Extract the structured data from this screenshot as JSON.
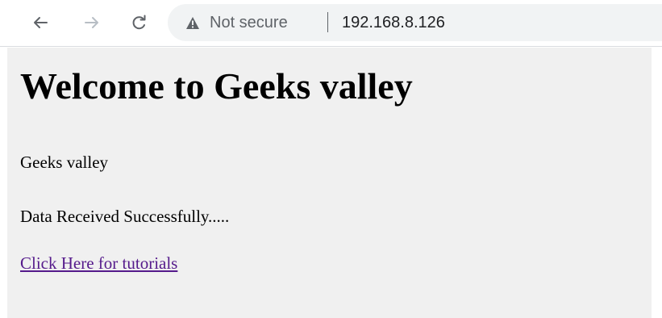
{
  "browser": {
    "security_label": "Not secure",
    "separator": "|",
    "url": "192.168.8.126",
    "icons": {
      "back": "arrow-left-icon",
      "forward": "arrow-right-icon",
      "reload": "reload-icon",
      "security": "warning-icon"
    },
    "colors": {
      "toolbar_background": "#ffffff",
      "omnibox_background": "#f1f3f4",
      "icon_active": "#5f6368",
      "icon_disabled": "#b8bec5",
      "url_text": "#202124"
    }
  },
  "page": {
    "heading": "Welcome to Geeks valley",
    "paragraphs": [
      "Geeks valley",
      "Data Received Successfully....."
    ],
    "link_text": "Click Here for tutorials",
    "colors": {
      "background": "#f0f0f0",
      "text": "#000000",
      "visited_link": "#551a8b"
    }
  }
}
